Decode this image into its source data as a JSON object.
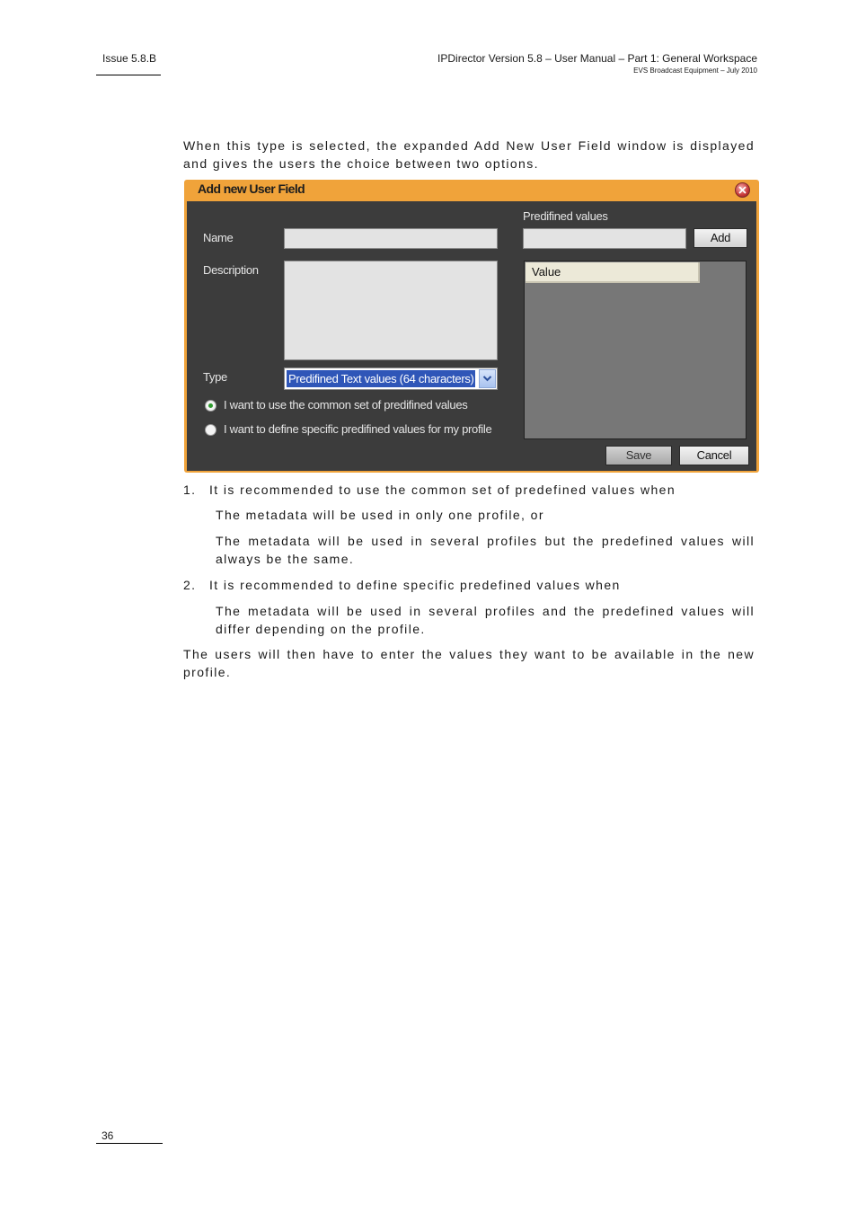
{
  "header": {
    "issue": "Issue 5.8.B",
    "title": "IPDirector Version 5.8 – User Manual – Part 1: General Workspace",
    "subtitle": "EVS Broadcast Equipment  – July 2010"
  },
  "intro": "When this type is selected, the expanded Add New User Field window is displayed and gives the users the choice between two options.",
  "dialog": {
    "title": "Add new User Field",
    "name_label": "Name",
    "description_label": "Description",
    "type_label": "Type",
    "type_value": "Predifined Text values (64 characters)",
    "radio_common": "I want to use the common set of predifined values",
    "radio_specific": "I want to define specific predifined values for my profile",
    "predefined_label": "Predifined values",
    "add_button": "Add",
    "grid_header": "Value",
    "save_button": "Save",
    "cancel_button": "Cancel",
    "selected_option": "common"
  },
  "list": {
    "item1_num": "1.",
    "item1": "It is recommended to use the common set of predefined values when",
    "item1_a": "The metadata will be used in only one profile, or",
    "item1_b": "The metadata will be used in several profiles but the predefined values will always be the same.",
    "item2_num": "2.",
    "item2": "It is recommended to define specific predefined values when",
    "item2_a": "The metadata will be used in several profiles and the predefined values will differ depending on the profile."
  },
  "closing": "The users will then have to enter the values they want to be available in the new profile.",
  "footer": {
    "page_number": "36"
  }
}
